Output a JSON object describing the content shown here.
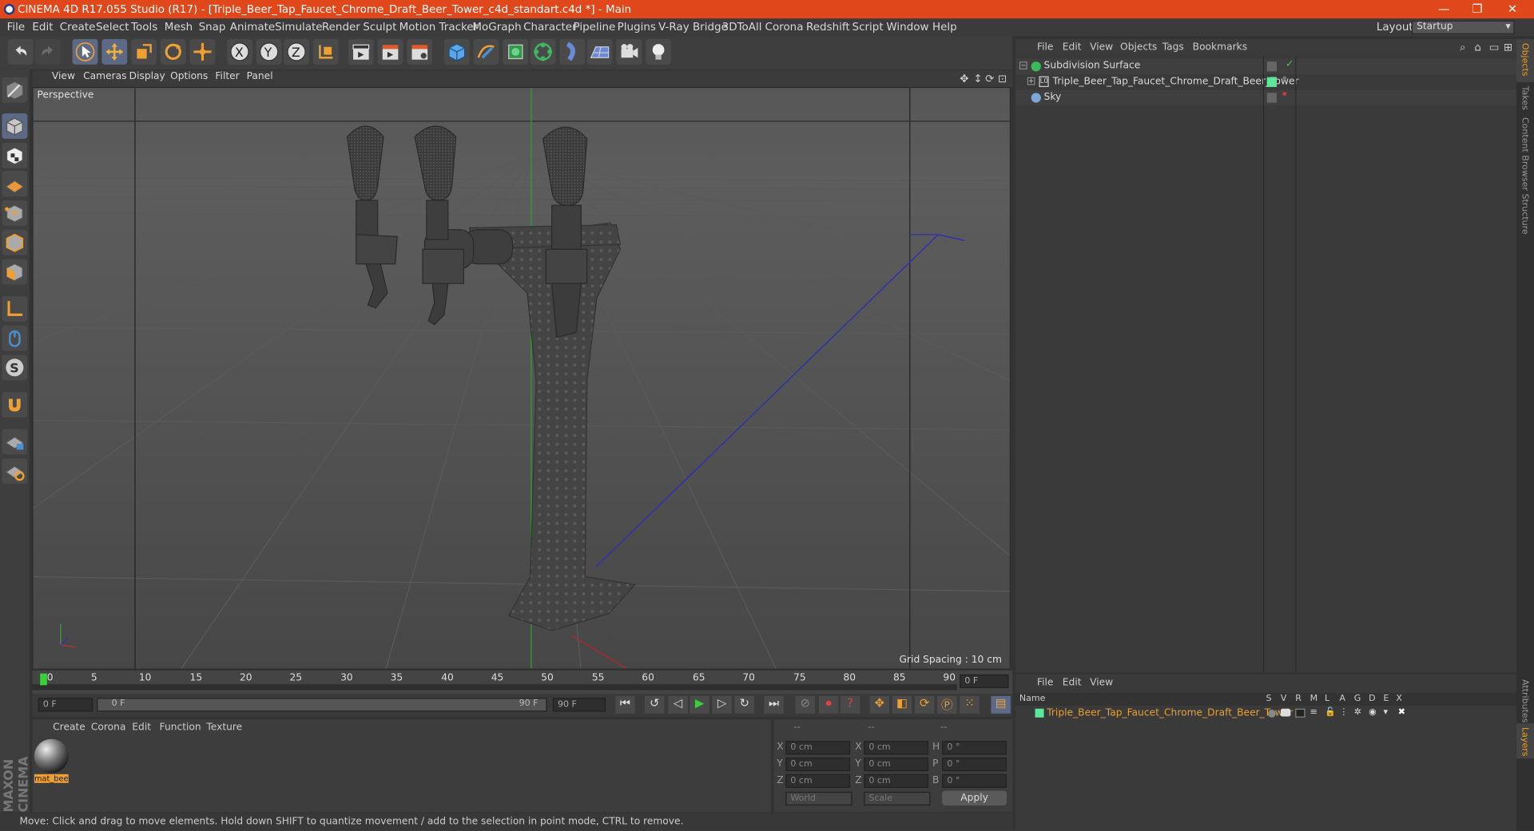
{
  "window": {
    "title": "CINEMA 4D R17.055 Studio (R17) - [Triple_Beer_Tap_Faucet_Chrome_Draft_Beer_Tower_c4d_standart.c4d *] - Main",
    "controls": [
      "—",
      "❐",
      "✕"
    ]
  },
  "menu": [
    "File",
    "Edit",
    "Create",
    "Select",
    "Tools",
    "Mesh",
    "Snap",
    "Animate",
    "Simulate",
    "Render",
    "Sculpt",
    "Motion Tracker",
    "MoGraph",
    "Character",
    "Pipeline",
    "Plugins",
    "V-Ray Bridge",
    "3DToAll",
    "Corona",
    "Redshift",
    "Script",
    "Window",
    "Help"
  ],
  "layout": {
    "label": "Layout:",
    "value": "Startup"
  },
  "viewport": {
    "menu": [
      "View",
      "Cameras",
      "Display",
      "Options",
      "Filter",
      "Panel"
    ],
    "label": "Perspective",
    "grid_spacing": "Grid Spacing : 10 cm"
  },
  "timeline": {
    "ticks": [
      "0",
      "5",
      "10",
      "15",
      "20",
      "25",
      "30",
      "35",
      "40",
      "45",
      "50",
      "55",
      "60",
      "65",
      "70",
      "75",
      "80",
      "85",
      "90"
    ],
    "current_frame": "0 F",
    "start_field": "0 F",
    "slider_left": "0 F",
    "slider_right": "90 F",
    "end_field": "90 F"
  },
  "material_manager": {
    "menu": [
      "Create",
      "Corona",
      "Edit",
      "Function",
      "Texture"
    ],
    "material_name": "mat_bee"
  },
  "coords": {
    "headers": [
      "--",
      "--",
      "--"
    ],
    "rows": [
      {
        "a": "X",
        "av": "0 cm",
        "b": "X",
        "bv": "0 cm",
        "c": "H",
        "cv": "0 °"
      },
      {
        "a": "Y",
        "av": "0 cm",
        "b": "Y",
        "bv": "0 cm",
        "c": "P",
        "cv": "0 °"
      },
      {
        "a": "Z",
        "av": "0 cm",
        "b": "Z",
        "bv": "0 cm",
        "c": "B",
        "cv": "0 °"
      }
    ],
    "world": "World",
    "scale": "Scale",
    "apply": "Apply"
  },
  "object_manager": {
    "menu": [
      "File",
      "Edit",
      "View",
      "Objects",
      "Tags",
      "Bookmarks"
    ],
    "objects": [
      {
        "name": "Subdivision Surface",
        "color": "#d9d9d9"
      },
      {
        "name": "Triple_Beer_Tap_Faucet_Chrome_Draft_Beer_Tower",
        "color": "#d9d9d9"
      },
      {
        "name": "Sky",
        "color": "#d9d9d9"
      }
    ]
  },
  "attributes": {
    "menu": [
      "File",
      "Edit",
      "View"
    ],
    "columns_label": "Name",
    "columns": [
      "S",
      "V",
      "R",
      "M",
      "L",
      "A",
      "G",
      "D",
      "E",
      "X"
    ],
    "layer_name": "Triple_Beer_Tap_Faucet_Chrome_Draft_Beer_Tower",
    "layer_color": "#e8a030"
  },
  "right_tabs": [
    "Objects",
    "Takes",
    "Content Browser",
    "Structure"
  ],
  "right_tabs_bottom": [
    "Attributes",
    "Layers"
  ],
  "status": "Move: Click and drag to move elements. Hold down SHIFT to quantize movement / add to the selection in point mode, CTRL to remove.",
  "brand": "MAXON CINEMA 4D"
}
